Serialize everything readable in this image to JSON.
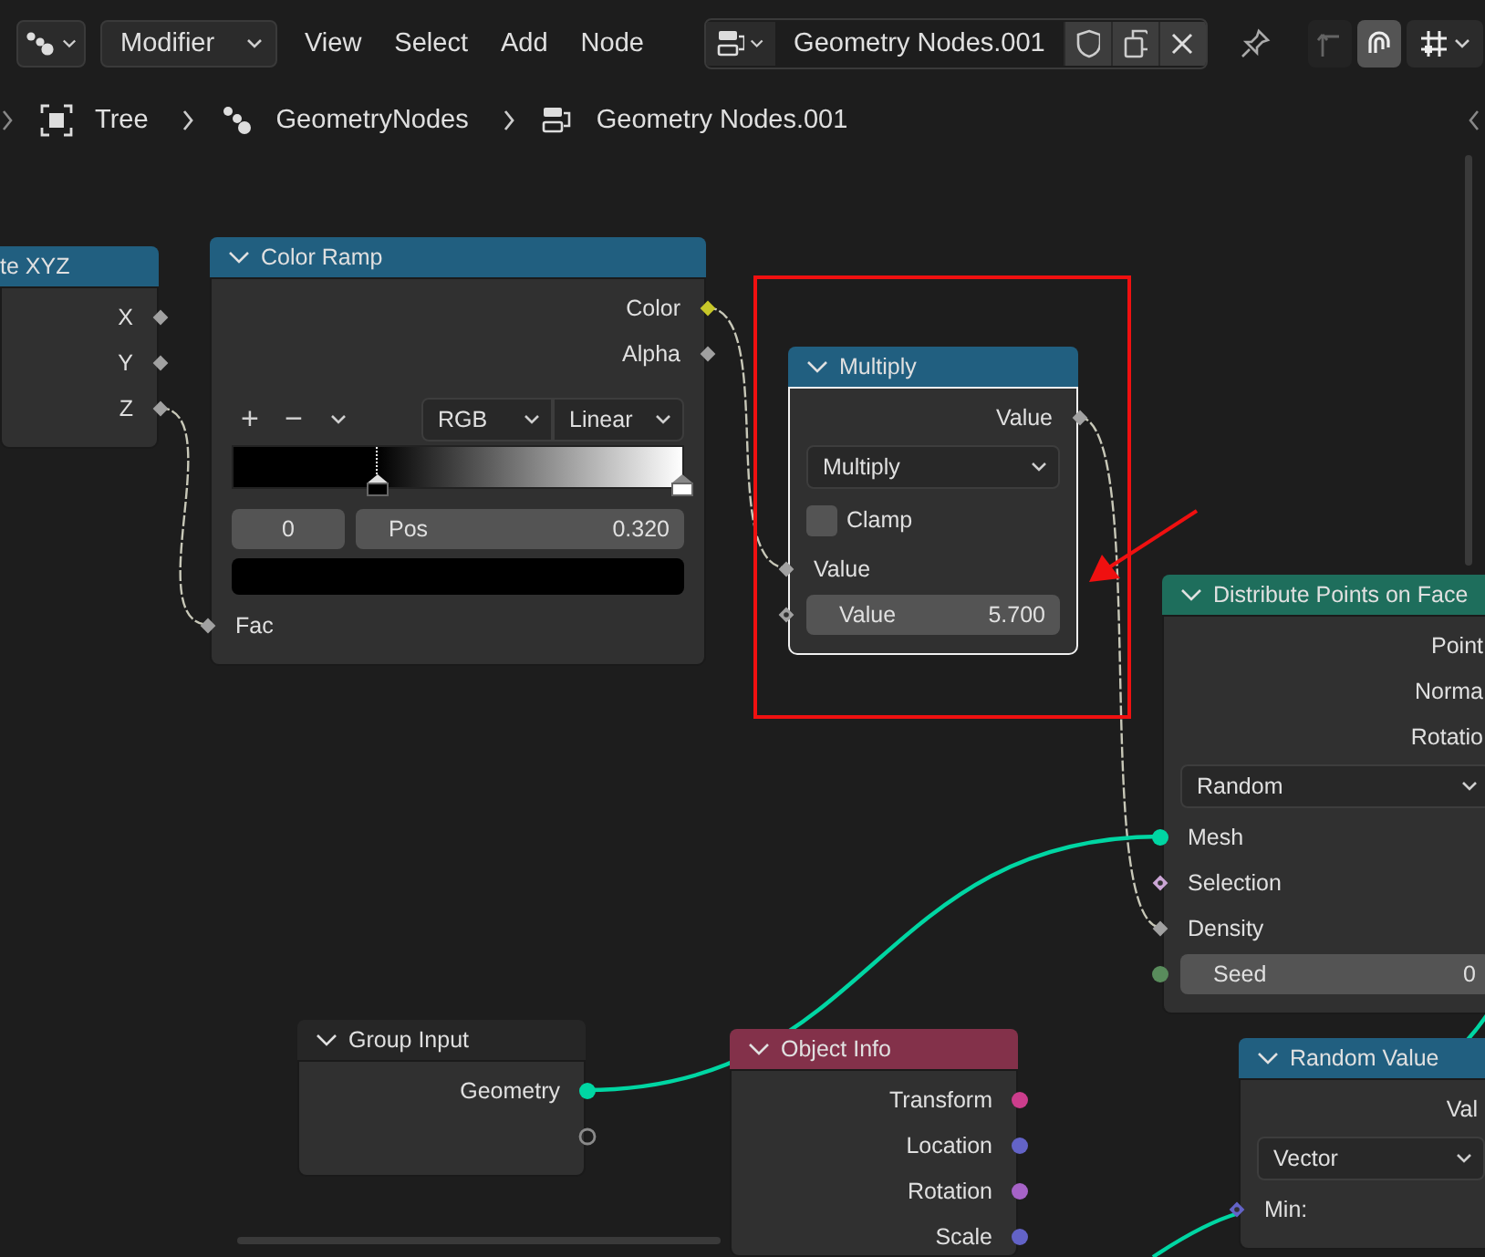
{
  "toolbar": {
    "mode": "Modifier",
    "menus": [
      "View",
      "Select",
      "Add",
      "Node"
    ],
    "node_group": "Geometry Nodes.001",
    "toggles": [
      {
        "kind": "parent",
        "disabled": true,
        "on": false
      },
      {
        "kind": "auto-offset",
        "disabled": false,
        "on": true
      },
      {
        "kind": "snap",
        "disabled": false,
        "on": false
      }
    ]
  },
  "breadcrumbs": [
    {
      "kind": "tree",
      "label": "Tree"
    },
    {
      "kind": "modifier",
      "label": "GeometryNodes"
    },
    {
      "kind": "node-group",
      "label": "Geometry Nodes.001"
    }
  ],
  "nodes": [
    {
      "title": "te XYZ",
      "color": "#215f80",
      "selected": false,
      "rows": [
        {
          "kind": "output",
          "label": "X",
          "socket": {
            "kind": "diamond",
            "color": "#a1a1a1"
          }
        },
        {
          "kind": "output",
          "label": "Y",
          "socket": {
            "kind": "diamond",
            "color": "#a1a1a1"
          }
        },
        {
          "kind": "output",
          "label": "Z",
          "socket": {
            "kind": "diamond",
            "color": "#a1a1a1"
          }
        }
      ]
    },
    {
      "title": "Color Ramp",
      "color": "#215f80",
      "selected": false,
      "rows": [
        {
          "kind": "output",
          "label": "Color",
          "socket": {
            "kind": "diamond",
            "color": "#c7c729"
          }
        },
        {
          "kind": "output",
          "label": "Alpha",
          "socket": {
            "kind": "diamond",
            "color": "#a1a1a1"
          }
        },
        {
          "kind": "ramp-tools",
          "add": "+",
          "remove": "−",
          "color_mode": "RGB",
          "interpolation": "Linear"
        },
        {
          "kind": "ramp",
          "stops": [
            {
              "level": 0.32,
              "color": "#000000",
              "selected": true
            },
            {
              "level": 1,
              "color": "#ffffff",
              "selected": false
            }
          ]
        },
        {
          "kind": "ramp-fields",
          "index": "0",
          "label": "Pos",
          "value": "0.320"
        },
        {
          "kind": "swatch",
          "color": "#000000"
        },
        {
          "kind": "input",
          "label": "Fac",
          "socket": {
            "kind": "diamond",
            "color": "#a1a1a1"
          }
        }
      ]
    },
    {
      "title": "Multiply",
      "color": "#215f80",
      "selected": true,
      "rows": [
        {
          "kind": "output",
          "label": "Value",
          "socket": {
            "kind": "diamond",
            "color": "#a1a1a1"
          }
        },
        {
          "kind": "dropdown",
          "value": "Multiply"
        },
        {
          "kind": "checkbox",
          "label": "Clamp",
          "checked": false
        },
        {
          "kind": "input",
          "label": "Value",
          "socket": {
            "kind": "diamond",
            "color": "#a1a1a1"
          }
        },
        {
          "kind": "field",
          "label": "Value",
          "value": "5.700",
          "socket": {
            "kind": "diamond-dot",
            "color": "#a1a1a1"
          }
        }
      ]
    },
    {
      "title": "Distribute Points on Face",
      "color": "#1e6e5c",
      "selected": false,
      "rows": [
        {
          "kind": "output",
          "label": "Point"
        },
        {
          "kind": "output",
          "label": "Norma"
        },
        {
          "kind": "output",
          "label": "Rotatio"
        },
        {
          "kind": "dropdown",
          "value": "Random"
        },
        {
          "kind": "input",
          "label": "Mesh",
          "socket": {
            "kind": "circle",
            "color": "#00d6a3"
          }
        },
        {
          "kind": "input",
          "label": "Selection",
          "socket": {
            "kind": "diamond-dot",
            "color": "#cca6d6"
          }
        },
        {
          "kind": "input",
          "label": "Density",
          "socket": {
            "kind": "diamond",
            "color": "#a1a1a1"
          }
        },
        {
          "kind": "field",
          "label": "Seed",
          "value": "0",
          "socket": {
            "kind": "circle",
            "color": "#598c5c"
          }
        }
      ]
    },
    {
      "title": "Group Input",
      "color": "#262626",
      "selected": false,
      "rows": [
        {
          "kind": "output",
          "label": "Geometry",
          "socket": {
            "kind": "circle",
            "color": "#00d6a3"
          }
        },
        {
          "kind": "output",
          "socket": {
            "kind": "circle-hollow",
            "color": "#8a8a8a"
          }
        }
      ]
    },
    {
      "title": "Object Info",
      "color": "#83314a",
      "selected": false,
      "rows": [
        {
          "kind": "output",
          "label": "Transform",
          "socket": {
            "kind": "circle",
            "color": "#cc3d8c"
          }
        },
        {
          "kind": "output",
          "label": "Location",
          "socket": {
            "kind": "circle",
            "color": "#6363c7"
          }
        },
        {
          "kind": "output",
          "label": "Rotation",
          "socket": {
            "kind": "circle",
            "color": "#a663c7"
          }
        },
        {
          "kind": "output",
          "label": "Scale",
          "socket": {
            "kind": "circle",
            "color": "#6363c7"
          }
        }
      ]
    },
    {
      "title": "Random Value",
      "color": "#215f80",
      "selected": false,
      "rows": [
        {
          "kind": "output",
          "label": "Val"
        },
        {
          "kind": "dropdown",
          "value": "Vector"
        },
        {
          "kind": "input",
          "label": "Min:",
          "socket": {
            "kind": "diamond-dot",
            "color": "#6363c7"
          }
        }
      ]
    }
  ]
}
